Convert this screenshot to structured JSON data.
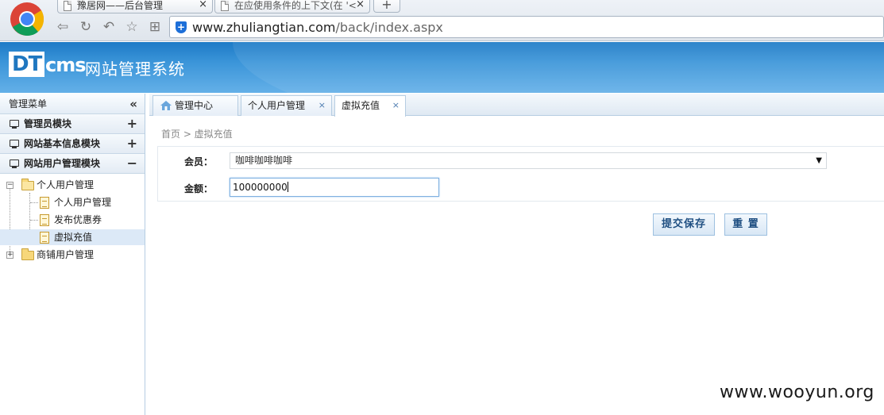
{
  "browser": {
    "tabs": [
      {
        "title": "豫居网——后台管理"
      },
      {
        "title": "在应使用条件的上下文(在 '<"
      }
    ],
    "new_tab_label": "+",
    "url_host": "www.zhuliangtian.com",
    "url_path": "/back/index.aspx"
  },
  "header": {
    "logo_dt": "DT",
    "logo_cms": "cms",
    "system_title": "网站管理系统"
  },
  "sidebar": {
    "menu_title": "管理菜单",
    "modules": [
      {
        "label": "管理员模块",
        "toggle": "+"
      },
      {
        "label": "网站基本信息模块",
        "toggle": "+"
      },
      {
        "label": "网站用户管理模块",
        "toggle": "−"
      }
    ],
    "tree": {
      "group1": "个人用户管理",
      "items": [
        "个人用户管理",
        "发布优惠券",
        "虚拟充值"
      ],
      "group2": "商铺用户管理"
    }
  },
  "main": {
    "tabs": [
      {
        "label": "管理中心"
      },
      {
        "label": "个人用户管理",
        "close": "×"
      },
      {
        "label": "虚拟充值",
        "close": "×"
      }
    ],
    "breadcrumb": "首页 > 虚拟充值",
    "form": {
      "member_label": "会员：",
      "member_value": "咖啡咖啡咖啡",
      "amount_label": "金额：",
      "amount_value": "100000000"
    },
    "buttons": {
      "submit": "提交保存",
      "reset": "重 置"
    }
  },
  "watermark": "www.wooyun.org",
  "colors": {
    "header_blue": "#1d7ac6",
    "link_blue": "#1f4f82"
  }
}
